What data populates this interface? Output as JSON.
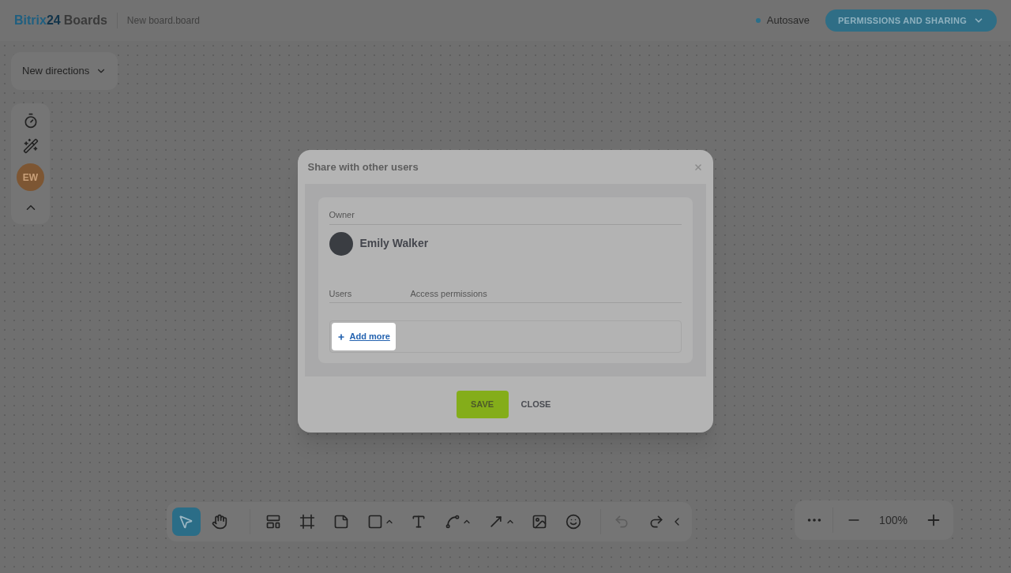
{
  "header": {
    "logo": {
      "brand": "Bitrix",
      "number": "24",
      "product": "Boards"
    },
    "board_name": "New board.board",
    "autosave": "Autosave",
    "permissions_button": "PERMISSIONS AND SHARING"
  },
  "directions": {
    "label": "New directions"
  },
  "side_panel": {
    "avatar_initials": "EW"
  },
  "dialog": {
    "title": "Share with other users",
    "owner_label": "Owner",
    "owner_name": "Emily Walker",
    "columns": [
      "Users",
      "Access permissions"
    ],
    "add_more": "Add more",
    "buttons": {
      "save": "SAVE",
      "close": "CLOSE"
    }
  },
  "toolbar": {
    "tools": [
      {
        "selected": true
      },
      {
        "selected": false
      },
      {
        "selected": false
      },
      {
        "selected": false
      },
      {
        "selected": false
      },
      {
        "selected": false
      },
      {
        "selected": false
      },
      {
        "selected": false
      },
      {
        "selected": false
      },
      {
        "selected": false
      },
      {
        "selected": false
      }
    ],
    "undo": {
      "disabled": true
    },
    "redo": {
      "disabled": false
    }
  },
  "zoom": {
    "value": "100%"
  }
}
